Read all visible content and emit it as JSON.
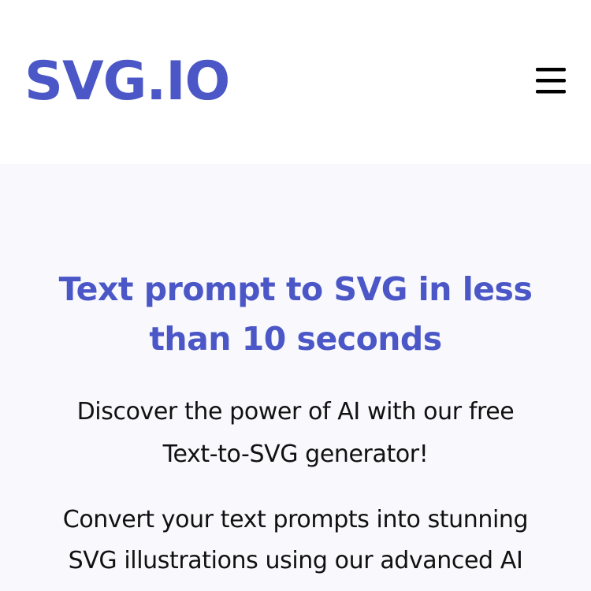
{
  "header": {
    "logo_text": "SVG.IO",
    "menu_icon": "hamburger-menu-icon"
  },
  "hero": {
    "title_lines": [
      "Text prompt to SVG in less",
      "than 10 seconds"
    ],
    "subtitle_lines": [
      "Discover the power of AI with our free",
      "Text-to-SVG generator!"
    ],
    "description_lines": [
      "Convert your text prompts into stunning",
      "SVG illustrations using our advanced AI"
    ]
  },
  "colors": {
    "brand": "#4b57c6",
    "hero_background": "#f8f8fd",
    "text": "#111111"
  }
}
